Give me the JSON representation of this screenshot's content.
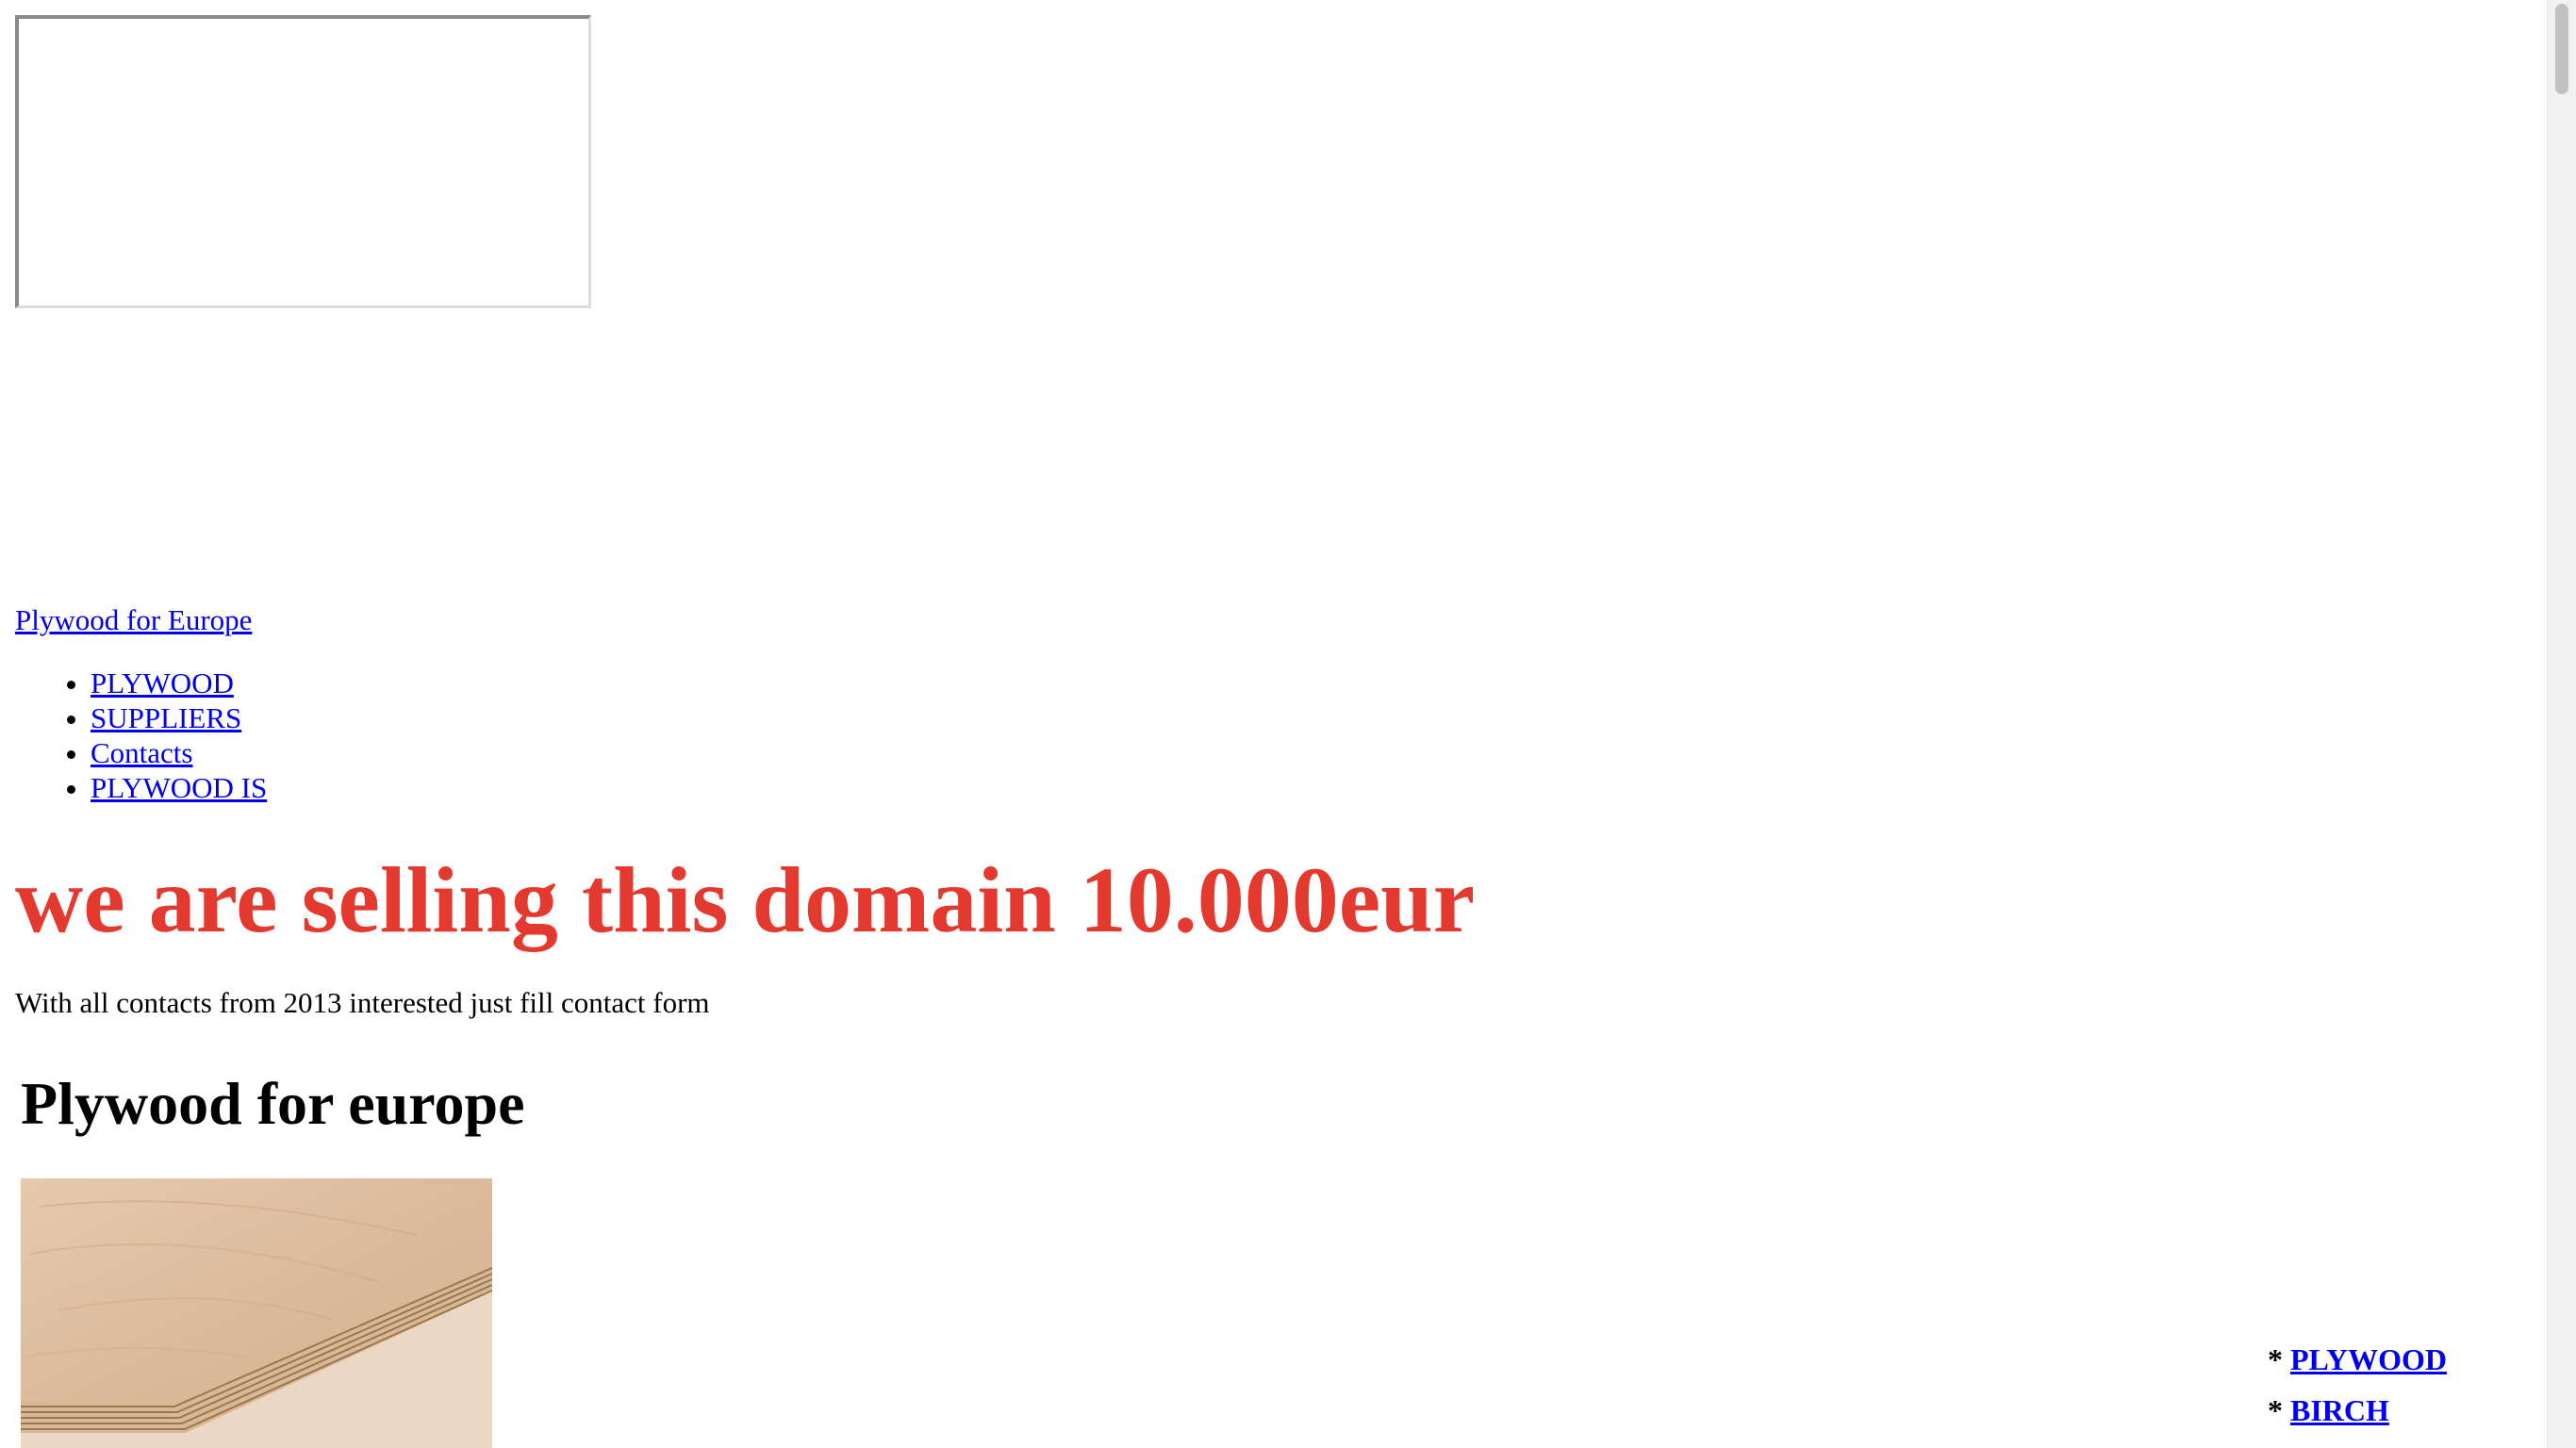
{
  "site_link": "Plywood for Europe",
  "nav": {
    "items": [
      {
        "label": "PLYWOOD"
      },
      {
        "label": "SUPPLIERS"
      },
      {
        "label": "Contacts"
      },
      {
        "label": "PLYWOOD IS"
      }
    ]
  },
  "sale": {
    "heading": "we are selling this domain 10.000eur",
    "subtext": "With all contacts from 2013 interested just fill contact form",
    "color": "#e3392e"
  },
  "main": {
    "heading": "Plywood for europe"
  },
  "side_links": {
    "bullet": "*",
    "items": [
      {
        "label": "PLYWOOD"
      },
      {
        "label": "BIRCH"
      }
    ]
  }
}
